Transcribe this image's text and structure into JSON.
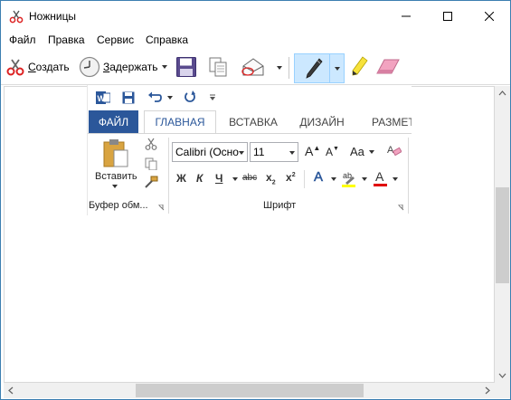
{
  "window": {
    "title": "Ножницы",
    "minimize_icon": "minimize-icon",
    "maximize_icon": "maximize-icon",
    "close_icon": "close-icon"
  },
  "menu": [
    "Файл",
    "Правка",
    "Сервис",
    "Справка"
  ],
  "toolbar": {
    "create_prefix": "С",
    "create_rest": "оздать",
    "delay_prefix": "З",
    "delay_rest": "адержать"
  },
  "snip": {
    "tabs": {
      "file": "ФАЙЛ",
      "home": "ГЛАВНАЯ",
      "insert": "ВСТАВКА",
      "design": "ДИЗАЙН",
      "layout": "РАЗМЕТ"
    },
    "paste_label": "Вставить",
    "clipboard_group": "Буфер обм...",
    "font_name": "Calibri (Осно",
    "font_size": "11",
    "font_group": "Шрифт",
    "grow_font": "A",
    "shrink_font": "A",
    "case_label": "Aa",
    "bold": "Ж",
    "italic": "К",
    "underline": "Ч",
    "strike": "abc",
    "subscript": "x",
    "superscript": "x",
    "sub_mark": "2",
    "sup_mark": "2",
    "text_effects": "A",
    "highlight_letters": "ab",
    "font_color": "A"
  },
  "colors": {
    "word_blue": "#2b579a",
    "pen_highlight": "#cce8ff",
    "highlight_yellow": "#ffff00",
    "font_red": "#e00000"
  }
}
